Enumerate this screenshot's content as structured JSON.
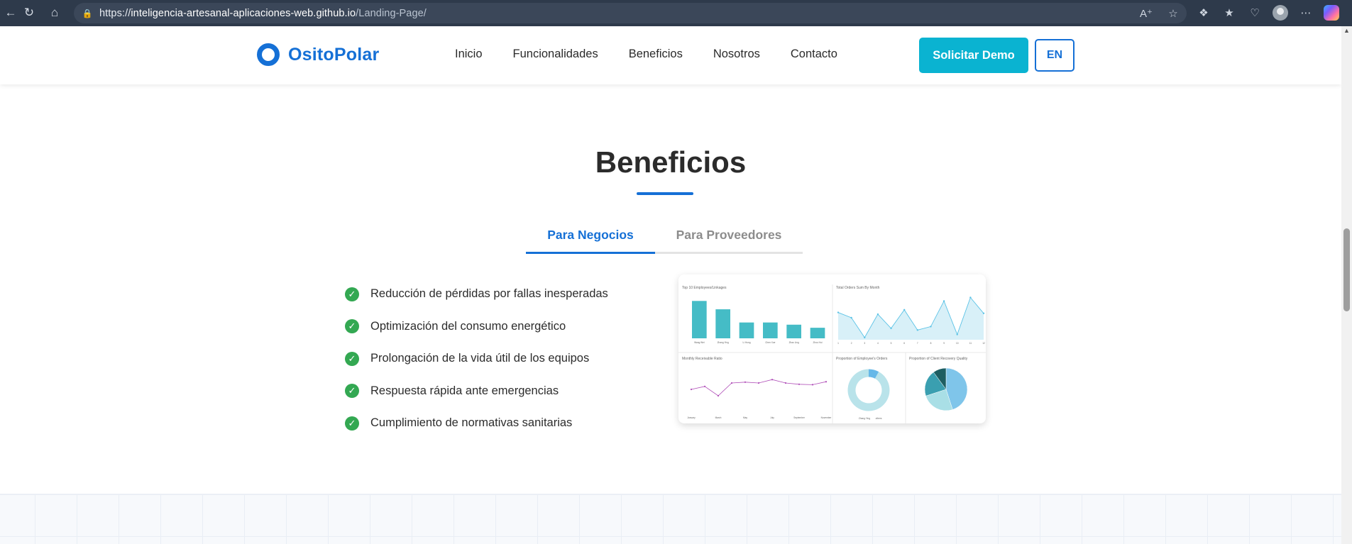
{
  "browser": {
    "url_prefix": "https://",
    "url_host": "inteligencia-artesanal-aplicaciones-web.github.io",
    "url_path": "/Landing-Page/",
    "icons": [
      "back-icon",
      "refresh-icon",
      "home-icon",
      "lock-icon",
      "read-aloud-icon",
      "favorite-star-icon",
      "extensions-icon",
      "favorites-icon",
      "health-icon",
      "profile-icon",
      "more-icon",
      "copilot-icon"
    ]
  },
  "header": {
    "brand": "OsitoPolar",
    "nav": [
      "Inicio",
      "Funcionalidades",
      "Beneficios",
      "Nosotros",
      "Contacto"
    ],
    "demo_button": "Solicitar Demo",
    "lang_button": "EN"
  },
  "section": {
    "title": "Beneficios",
    "tabs": [
      {
        "label": "Para Negocios",
        "active": true
      },
      {
        "label": "Para Proveedores",
        "active": false
      }
    ],
    "benefits": [
      "Reducción de pérdidas por fallas inesperadas",
      "Optimización del consumo energético",
      "Prolongación de la vida útil de los equipos",
      "Respuesta rápida ante emergencias",
      "Cumplimiento de normativas sanitarias"
    ]
  },
  "colors": {
    "brand": "#1570d6",
    "demo_button": "#0ab3d1",
    "check": "#33a852",
    "bar": "#45bcc6",
    "line": "#5cc3e6",
    "ratio_line": "#b04fb8"
  },
  "chart_data": [
    {
      "type": "bar",
      "title": "Top 10 Employees/Linkages",
      "categories": [
        "Wang Wei",
        "Zhang Ying",
        "Li Hong",
        "Chen Xue",
        "Zhao Ling",
        "Zhou Hui"
      ],
      "values": [
        85,
        66,
        36,
        36,
        31,
        24
      ],
      "ylim": [
        0,
        100
      ]
    },
    {
      "type": "area",
      "title": "Total Orders Sum By Month",
      "x": [
        1,
        2,
        3,
        4,
        5,
        6,
        7,
        8,
        9,
        10,
        11,
        12
      ],
      "values": [
        62,
        50,
        5,
        58,
        26,
        68,
        22,
        30,
        88,
        12,
        96,
        60
      ],
      "ylim": [
        0,
        100
      ]
    },
    {
      "type": "line",
      "title": "Monthly Receivable Ratio",
      "x": [
        "January",
        "March",
        "May",
        "July",
        "September",
        "November"
      ],
      "values": [
        55,
        62,
        40,
        70,
        72,
        70,
        78,
        70,
        67,
        66,
        73
      ],
      "ylim": [
        0,
        100
      ]
    },
    {
      "type": "pie",
      "title": "Proportion of Employee's Orders",
      "values": [
        8,
        92
      ],
      "labels": [
        "Zhang Ying",
        "others"
      ]
    },
    {
      "type": "pie",
      "title": "Proportion of Client Recovery Quality",
      "values": [
        45,
        25,
        20,
        10
      ]
    }
  ]
}
